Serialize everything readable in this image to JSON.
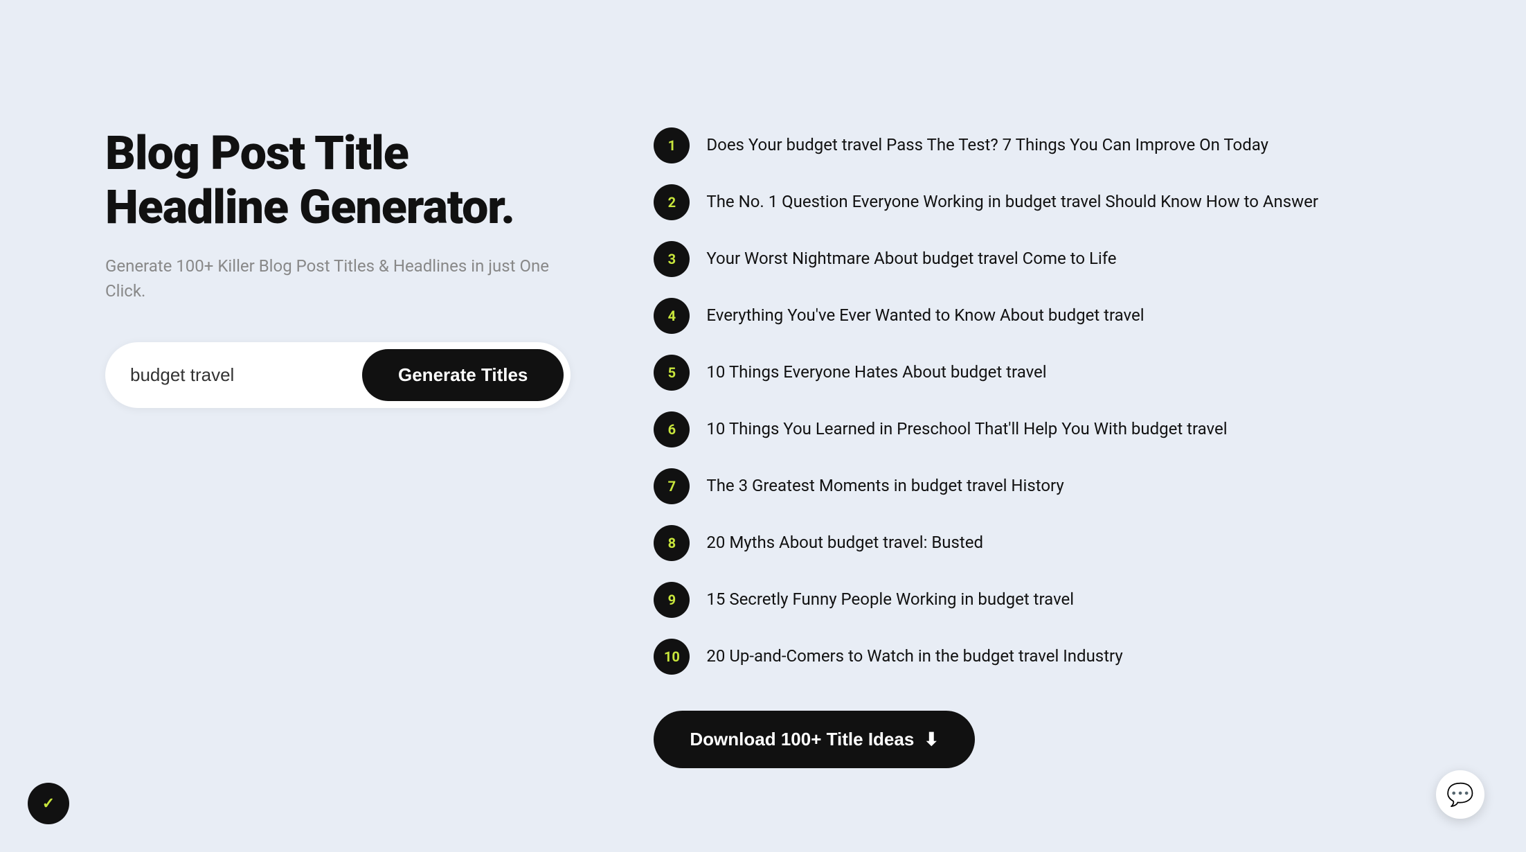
{
  "page": {
    "background": "#e8edf5"
  },
  "left": {
    "title": "Blog Post Title Headline Generator.",
    "subtitle": "Generate 100+ Killer Blog Post Titles & Headlines in just One Click.",
    "input": {
      "value": "budget travel",
      "placeholder": "budget travel"
    },
    "generate_button": "Generate Titles"
  },
  "right": {
    "titles": [
      {
        "number": "1",
        "text": "Does Your budget travel Pass The Test? 7 Things You Can Improve On Today"
      },
      {
        "number": "2",
        "text": "The No. 1 Question Everyone Working in budget travel Should Know How to Answer"
      },
      {
        "number": "3",
        "text": "Your Worst Nightmare About budget travel Come to Life"
      },
      {
        "number": "4",
        "text": "Everything You've Ever Wanted to Know About budget travel"
      },
      {
        "number": "5",
        "text": "10 Things Everyone Hates About budget travel"
      },
      {
        "number": "6",
        "text": "10 Things You Learned in Preschool That'll Help You With budget travel"
      },
      {
        "number": "7",
        "text": "The 3 Greatest Moments in budget travel History"
      },
      {
        "number": "8",
        "text": "20 Myths About budget travel: Busted"
      },
      {
        "number": "9",
        "text": "15 Secretly Funny People Working in budget travel"
      },
      {
        "number": "10",
        "text": "20 Up-and-Comers to Watch in the budget travel Industry"
      }
    ],
    "download_button": "Download 100+ Title Ideas"
  },
  "chat_button": {
    "icon": "💬"
  }
}
